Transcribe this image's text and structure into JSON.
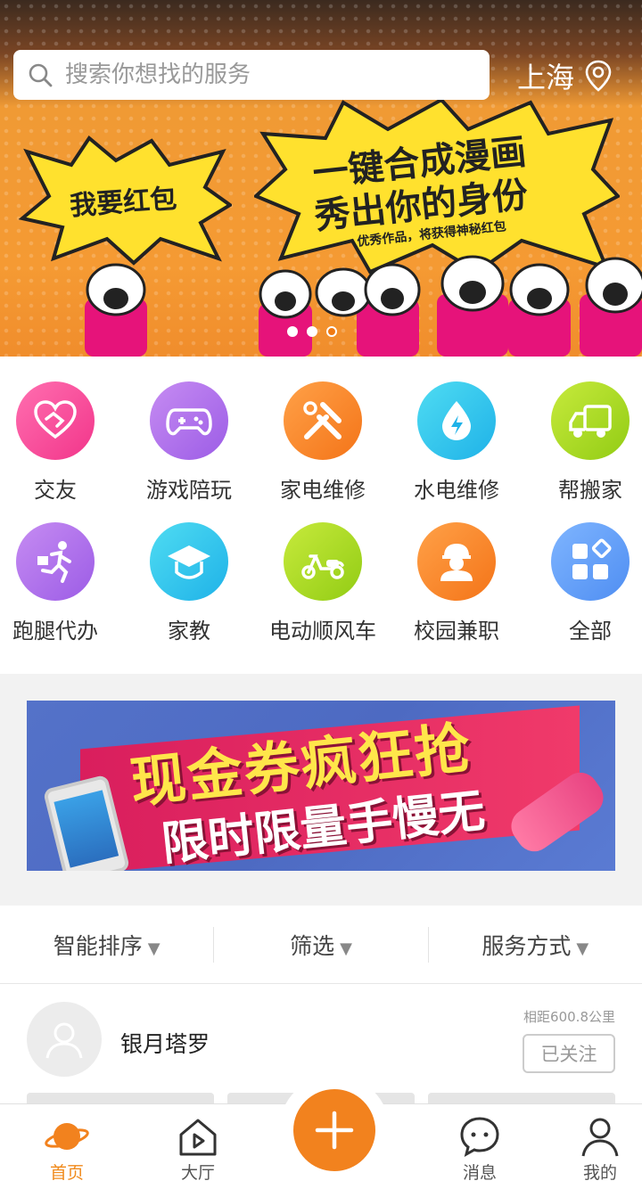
{
  "search": {
    "placeholder": "搜索你想找的服务"
  },
  "location": {
    "city": "上海"
  },
  "banner": {
    "burst_left": "我要红包",
    "line1": "一键合成漫画",
    "line2": "秀出你的身份",
    "line3": "优秀作品，将获得神秘红包",
    "slides_total": 3,
    "slide_active": 3
  },
  "categories": [
    {
      "label": "交友",
      "icon": "handshake-heart-icon",
      "color1": "#ff6fb0",
      "color2": "#f2358a"
    },
    {
      "label": "游戏陪玩",
      "icon": "gamepad-icon",
      "color1": "#c68cf2",
      "color2": "#9c5ce6"
    },
    {
      "label": "家电维修",
      "icon": "tools-icon",
      "color1": "#ffa148",
      "color2": "#f47418"
    },
    {
      "label": "水电维修",
      "icon": "water-lightning-icon",
      "color1": "#4fdcf2",
      "color2": "#1fb2e8"
    },
    {
      "label": "帮搬家",
      "icon": "truck-icon",
      "color1": "#c7ea3c",
      "color2": "#92cc14"
    },
    {
      "label": "跑腿代办",
      "icon": "runner-icon",
      "color1": "#c68cf2",
      "color2": "#9c5ce6"
    },
    {
      "label": "家教",
      "icon": "graduation-cap-icon",
      "color1": "#4fdcf2",
      "color2": "#1fb2e8"
    },
    {
      "label": "电动顺风车",
      "icon": "scooter-icon",
      "color1": "#c7ea3c",
      "color2": "#92cc14"
    },
    {
      "label": "校园兼职",
      "icon": "worker-icon",
      "color1": "#ffa148",
      "color2": "#f47418"
    },
    {
      "label": "全部",
      "icon": "grid-all-icon",
      "color1": "#7fb5ff",
      "color2": "#4f8ef2"
    }
  ],
  "promo": {
    "line1": "现金券疯狂抢",
    "line2": "限时限量手慢无"
  },
  "filters": [
    {
      "label": "智能排序",
      "arrow": "▼"
    },
    {
      "label": "筛选",
      "arrow": "▼"
    },
    {
      "label": "服务方式",
      "arrow": "▼"
    }
  ],
  "listing": {
    "name": "银月塔罗",
    "distance": "相距600.8公里",
    "follow_label": "已关注"
  },
  "tabs": {
    "home": "首页",
    "hall": "大厅",
    "messages": "消息",
    "mine": "我的"
  },
  "colors": {
    "accent": "#f2821e",
    "text": "#333333"
  }
}
